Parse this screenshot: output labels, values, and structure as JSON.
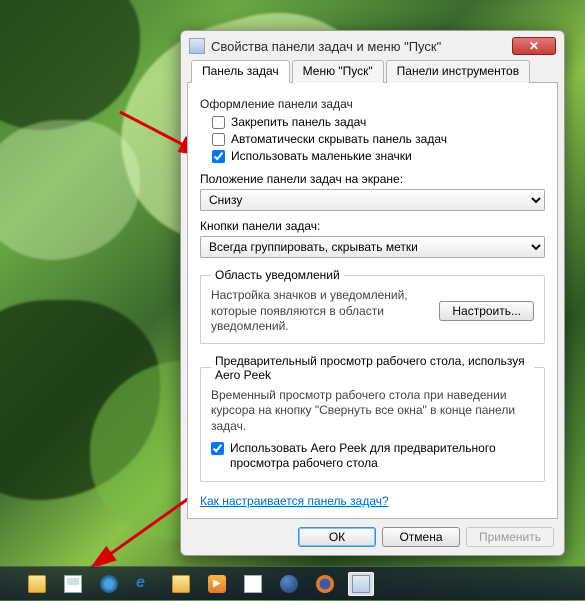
{
  "window": {
    "title": "Свойства панели задач и меню \"Пуск\"",
    "close_icon": "close-icon"
  },
  "tabs": [
    {
      "label": "Панель задач",
      "active": true
    },
    {
      "label": "Меню \"Пуск\"",
      "active": false
    },
    {
      "label": "Панели инструментов",
      "active": false
    }
  ],
  "appearance": {
    "section_label": "Оформление панели задач",
    "lock": {
      "label": "Закрепить панель задач",
      "checked": false
    },
    "autohide": {
      "label": "Автоматически скрывать панель задач",
      "checked": false
    },
    "small_icons": {
      "label": "Использовать маленькие значки",
      "checked": true
    }
  },
  "position": {
    "label": "Положение панели задач на экране:",
    "value": "Снизу"
  },
  "buttons_mode": {
    "label": "Кнопки панели задач:",
    "value": "Всегда группировать, скрывать метки"
  },
  "notification": {
    "legend": "Область уведомлений",
    "text": "Настройка значков и уведомлений, которые появляются в области уведомлений.",
    "button": "Настроить..."
  },
  "aero_peek": {
    "legend": "Предварительный просмотр рабочего стола, используя Aero Peek",
    "text": "Временный просмотр рабочего стола при наведении курсора на кнопку \"Свернуть все окна\" в конце панели задач.",
    "checkbox": {
      "label": "Использовать Aero Peek для предварительного просмотра рабочего стола",
      "checked": true
    }
  },
  "help_link": "Как настраивается панель задач?",
  "dlg_buttons": {
    "ok": "ОК",
    "cancel": "Отмена",
    "apply": "Применить"
  },
  "taskbar_icons": [
    "explorer",
    "mail",
    "mediacenter",
    "ie",
    "folder",
    "wmp",
    "notes",
    "globe",
    "firefox",
    "taskbar-props"
  ]
}
